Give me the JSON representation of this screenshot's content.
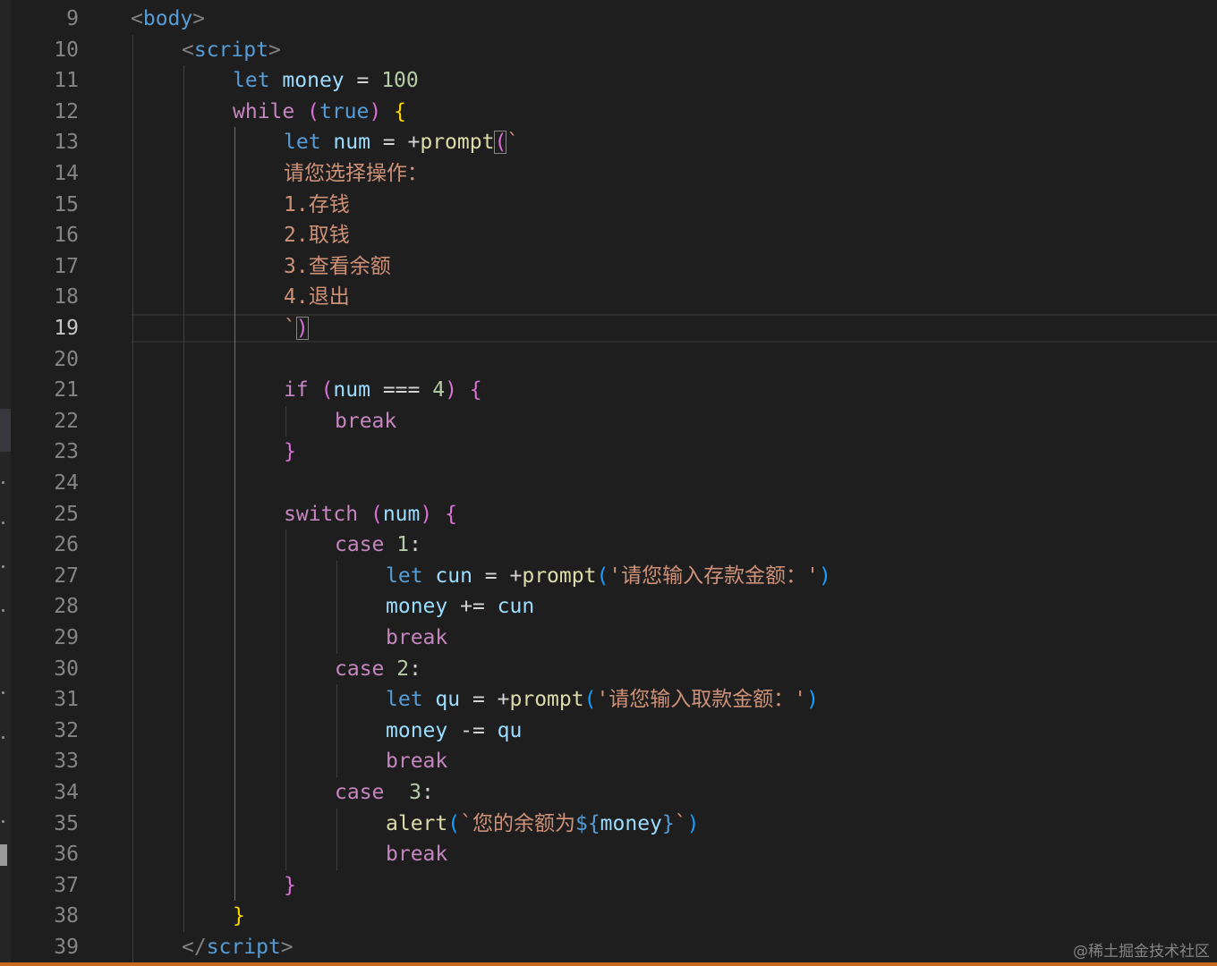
{
  "editor": {
    "active_line": 19,
    "watermark": "@稀土掘金技术社区"
  },
  "lines": [
    {
      "n": 9,
      "indent": 0,
      "tokens": [
        [
          "<",
          "t-tag"
        ],
        [
          "body",
          "t-tagn"
        ],
        [
          ">",
          "t-tag"
        ]
      ]
    },
    {
      "n": 10,
      "indent": 1,
      "tokens": [
        [
          "<",
          "t-tag"
        ],
        [
          "script",
          "t-tagn"
        ],
        [
          ">",
          "t-tag"
        ]
      ]
    },
    {
      "n": 11,
      "indent": 2,
      "tokens": [
        [
          "let",
          "t-kw"
        ],
        [
          " ",
          "t-op"
        ],
        [
          "money",
          "t-var"
        ],
        [
          " = ",
          "t-op"
        ],
        [
          "100",
          "t-num"
        ]
      ]
    },
    {
      "n": 12,
      "indent": 2,
      "tokens": [
        [
          "while",
          "t-ctl"
        ],
        [
          " ",
          "t-op"
        ],
        [
          "(",
          "t-b2"
        ],
        [
          "true",
          "t-kw"
        ],
        [
          ")",
          "t-b2"
        ],
        [
          " ",
          "t-op"
        ],
        [
          "{",
          "t-b1"
        ]
      ]
    },
    {
      "n": 13,
      "indent": 3,
      "tokens": [
        [
          "let",
          "t-kw"
        ],
        [
          " ",
          "t-op"
        ],
        [
          "num",
          "t-var"
        ],
        [
          " = +",
          "t-op"
        ],
        [
          "prompt",
          "t-fn"
        ],
        [
          "(",
          "t-b2 bm"
        ],
        [
          "`",
          "t-str"
        ]
      ]
    },
    {
      "n": 14,
      "indent": 3,
      "tokens": [
        [
          "请您选择操作：",
          "t-str"
        ]
      ]
    },
    {
      "n": 15,
      "indent": 3,
      "tokens": [
        [
          "1.存钱",
          "t-str"
        ]
      ]
    },
    {
      "n": 16,
      "indent": 3,
      "tokens": [
        [
          "2.取钱",
          "t-str"
        ]
      ]
    },
    {
      "n": 17,
      "indent": 3,
      "tokens": [
        [
          "3.查看余额",
          "t-str"
        ]
      ]
    },
    {
      "n": 18,
      "indent": 3,
      "tokens": [
        [
          "4.退出",
          "t-str"
        ]
      ]
    },
    {
      "n": 19,
      "indent": 3,
      "tokens": [
        [
          "`",
          "t-str"
        ],
        [
          ")",
          "t-b2 bm"
        ]
      ]
    },
    {
      "n": 20,
      "indent": 0,
      "tokens": []
    },
    {
      "n": 21,
      "indent": 3,
      "tokens": [
        [
          "if",
          "t-ctl"
        ],
        [
          " ",
          "t-op"
        ],
        [
          "(",
          "t-b2"
        ],
        [
          "num",
          "t-var"
        ],
        [
          " === ",
          "t-op"
        ],
        [
          "4",
          "t-num"
        ],
        [
          ")",
          "t-b2"
        ],
        [
          " ",
          "t-op"
        ],
        [
          "{",
          "t-b2"
        ]
      ]
    },
    {
      "n": 22,
      "indent": 4,
      "tokens": [
        [
          "break",
          "t-ctl"
        ]
      ]
    },
    {
      "n": 23,
      "indent": 3,
      "tokens": [
        [
          "}",
          "t-b2"
        ]
      ]
    },
    {
      "n": 24,
      "indent": 0,
      "tokens": []
    },
    {
      "n": 25,
      "indent": 3,
      "tokens": [
        [
          "switch",
          "t-ctl"
        ],
        [
          " ",
          "t-op"
        ],
        [
          "(",
          "t-b2"
        ],
        [
          "num",
          "t-var"
        ],
        [
          ")",
          "t-b2"
        ],
        [
          " ",
          "t-op"
        ],
        [
          "{",
          "t-b2"
        ]
      ]
    },
    {
      "n": 26,
      "indent": 4,
      "tokens": [
        [
          "case",
          "t-ctl"
        ],
        [
          " ",
          "t-op"
        ],
        [
          "1",
          "t-num"
        ],
        [
          ":",
          "t-op"
        ]
      ]
    },
    {
      "n": 27,
      "indent": 5,
      "tokens": [
        [
          "let",
          "t-kw"
        ],
        [
          " ",
          "t-op"
        ],
        [
          "cun",
          "t-var"
        ],
        [
          " = +",
          "t-op"
        ],
        [
          "prompt",
          "t-fn"
        ],
        [
          "(",
          "t-b3"
        ],
        [
          "'请您输入存款金额：'",
          "t-str"
        ],
        [
          ")",
          "t-b3"
        ]
      ]
    },
    {
      "n": 28,
      "indent": 5,
      "tokens": [
        [
          "money",
          "t-var"
        ],
        [
          " += ",
          "t-op"
        ],
        [
          "cun",
          "t-var"
        ]
      ]
    },
    {
      "n": 29,
      "indent": 5,
      "tokens": [
        [
          "break",
          "t-ctl"
        ]
      ]
    },
    {
      "n": 30,
      "indent": 4,
      "tokens": [
        [
          "case",
          "t-ctl"
        ],
        [
          " ",
          "t-op"
        ],
        [
          "2",
          "t-num"
        ],
        [
          ":",
          "t-op"
        ]
      ]
    },
    {
      "n": 31,
      "indent": 5,
      "tokens": [
        [
          "let",
          "t-kw"
        ],
        [
          " ",
          "t-op"
        ],
        [
          "qu",
          "t-var"
        ],
        [
          " = +",
          "t-op"
        ],
        [
          "prompt",
          "t-fn"
        ],
        [
          "(",
          "t-b3"
        ],
        [
          "'请您输入取款金额：'",
          "t-str"
        ],
        [
          ")",
          "t-b3"
        ]
      ]
    },
    {
      "n": 32,
      "indent": 5,
      "tokens": [
        [
          "money",
          "t-var"
        ],
        [
          " -= ",
          "t-op"
        ],
        [
          "qu",
          "t-var"
        ]
      ]
    },
    {
      "n": 33,
      "indent": 5,
      "tokens": [
        [
          "break",
          "t-ctl"
        ]
      ]
    },
    {
      "n": 34,
      "indent": 4,
      "tokens": [
        [
          "case",
          "t-ctl"
        ],
        [
          "  ",
          "t-op"
        ],
        [
          "3",
          "t-num"
        ],
        [
          ":",
          "t-op"
        ]
      ]
    },
    {
      "n": 35,
      "indent": 5,
      "tokens": [
        [
          "alert",
          "t-fn"
        ],
        [
          "(",
          "t-b3"
        ],
        [
          "`您的余额为",
          "t-str"
        ],
        [
          "${",
          "t-kw"
        ],
        [
          "money",
          "t-var"
        ],
        [
          "}",
          "t-kw"
        ],
        [
          "`",
          "t-str"
        ],
        [
          ")",
          "t-b3"
        ]
      ]
    },
    {
      "n": 36,
      "indent": 5,
      "tokens": [
        [
          "break",
          "t-ctl"
        ]
      ]
    },
    {
      "n": 37,
      "indent": 3,
      "tokens": [
        [
          "}",
          "t-b2"
        ]
      ]
    },
    {
      "n": 38,
      "indent": 2,
      "tokens": [
        [
          "}",
          "t-b1"
        ]
      ]
    },
    {
      "n": 39,
      "indent": 1,
      "tokens": [
        [
          "</",
          "t-tag"
        ],
        [
          "script",
          "t-tagn"
        ],
        [
          ">",
          "t-tag"
        ]
      ]
    }
  ]
}
